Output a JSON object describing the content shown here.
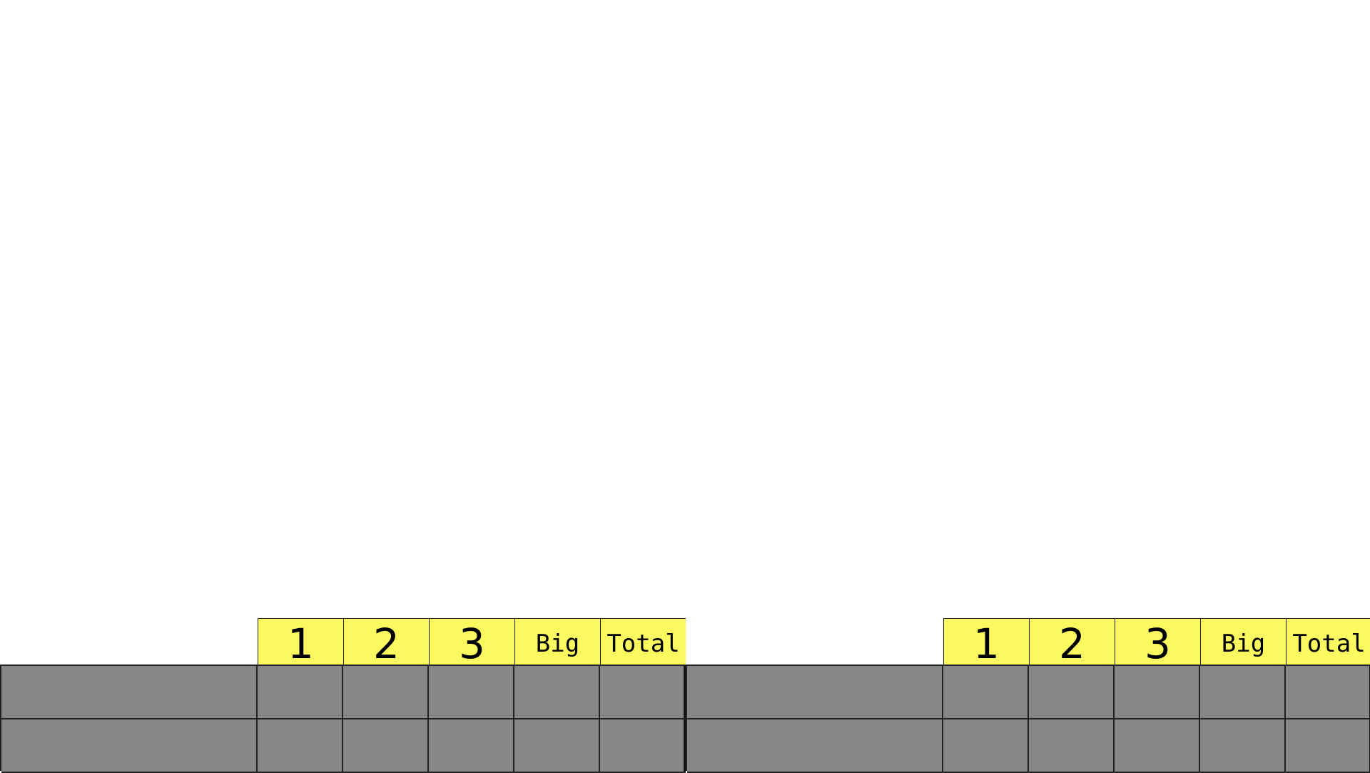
{
  "boards": [
    {
      "id": "left",
      "headers": [
        "1",
        "2",
        "3",
        "Big",
        "Total"
      ],
      "rows": [
        {
          "name": "",
          "scores": [
            "",
            "",
            "",
            "",
            ""
          ]
        },
        {
          "name": "",
          "scores": [
            "",
            "",
            "",
            "",
            ""
          ]
        }
      ]
    },
    {
      "id": "right",
      "headers": [
        "1",
        "2",
        "3",
        "Big",
        "Total"
      ],
      "rows": [
        {
          "name": "",
          "scores": [
            "",
            "",
            "",
            "",
            ""
          ]
        },
        {
          "name": "",
          "scores": [
            "",
            "",
            "",
            "",
            ""
          ]
        }
      ]
    }
  ],
  "colors": {
    "header_fill": "#fcf860",
    "cell_fill": "#878787",
    "border": "#222222",
    "background": "#ffffff"
  }
}
